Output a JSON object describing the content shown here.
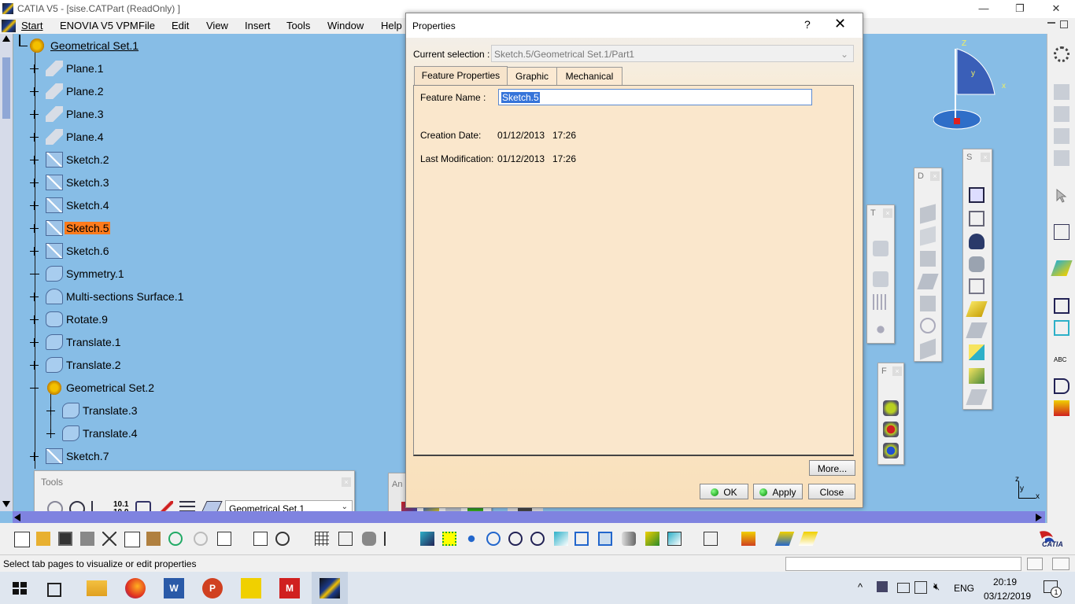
{
  "window": {
    "title": "CATIA V5 - [sise.CATPart (ReadOnly) ]",
    "minimize_glyph": "—",
    "restore_glyph": "❐",
    "close_glyph": "✕"
  },
  "menubar": {
    "items": [
      "Start",
      "ENOVIA V5 VPM",
      "File",
      "Edit",
      "View",
      "Insert",
      "Tools",
      "Window",
      "Help"
    ]
  },
  "tree": {
    "items": [
      {
        "label": "Geometrical Set.1",
        "icon": "geometrical-set-icon"
      },
      {
        "label": "Plane.1",
        "icon": "plane-icon"
      },
      {
        "label": "Plane.2",
        "icon": "plane-icon"
      },
      {
        "label": "Plane.3",
        "icon": "plane-icon"
      },
      {
        "label": "Plane.4",
        "icon": "plane-icon"
      },
      {
        "label": "Sketch.2",
        "icon": "sketch-icon"
      },
      {
        "label": "Sketch.3",
        "icon": "sketch-icon"
      },
      {
        "label": "Sketch.4",
        "icon": "sketch-icon"
      },
      {
        "label": "Sketch.5",
        "icon": "sketch-icon",
        "selected": true
      },
      {
        "label": "Sketch.6",
        "icon": "sketch-icon"
      },
      {
        "label": "Symmetry.1",
        "icon": "symmetry-icon"
      },
      {
        "label": "Multi-sections Surface.1",
        "icon": "multi-sections-surface-icon"
      },
      {
        "label": "Rotate.9",
        "icon": "rotate-icon"
      },
      {
        "label": "Translate.1",
        "icon": "translate-icon"
      },
      {
        "label": "Translate.2",
        "icon": "translate-icon"
      },
      {
        "label": "Geometrical Set.2",
        "icon": "geometrical-set-icon"
      },
      {
        "label": "Translate.3",
        "icon": "translate-icon"
      },
      {
        "label": "Translate.4",
        "icon": "translate-icon"
      },
      {
        "label": "Sketch.7",
        "icon": "sketch-icon"
      }
    ]
  },
  "dialog": {
    "title": "Properties",
    "help_glyph": "?",
    "close_glyph": "✕",
    "current_selection_label": "Current selection :",
    "current_selection_value": "Sketch.5/Geometrical Set.1/Part1",
    "tabs": [
      "Feature Properties",
      "Graphic",
      "Mechanical"
    ],
    "active_tab": "Feature Properties",
    "feature_name_label": "Feature Name :",
    "feature_name_value": "Sketch.5",
    "creation_date_label": "Creation Date:",
    "creation_date_value": "01/12/2013",
    "creation_time_value": "17:26",
    "last_mod_label": "Last Modification:",
    "last_mod_date_value": "01/12/2013",
    "last_mod_time_value": "17:26",
    "more_button": "More...",
    "ok_button": "OK",
    "apply_button": "Apply",
    "close_button": "Close"
  },
  "tools_toolbar": {
    "title": "Tools",
    "dropdown_value": "Geometrical Set.1"
  },
  "floating_toolbars": {
    "t_label": "T",
    "d_label": "D",
    "s_label": "S",
    "f_label": "F",
    "an_label": "An"
  },
  "compass": {
    "z_label": "Z",
    "y_label": "y",
    "x_label": "x"
  },
  "axis": {
    "z": "z",
    "y": "y",
    "x": "x"
  },
  "status": {
    "text": "Select tab pages to visualize or edit properties"
  },
  "catia_logo": "CATIA",
  "taskbar": {
    "language": "ENG",
    "time": "20:19",
    "date": "03/12/2019",
    "notification_count": "1"
  },
  "colors": {
    "background": "#87bde6",
    "selection": "#ff7b1c",
    "scrollbar": "#7f83e0"
  }
}
